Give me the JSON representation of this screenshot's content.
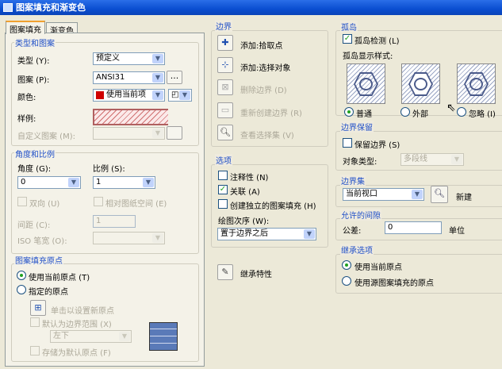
{
  "window": {
    "title": "图案填充和渐变色"
  },
  "tabs": [
    "图案填充",
    "渐变色"
  ],
  "type_pattern": {
    "group": "类型和图案",
    "type_label": "类型 (Y):",
    "type_value": "预定义",
    "pattern_label": "图案 (P):",
    "pattern_value": "ANSI31",
    "browse": "...",
    "color_label": "颜色:",
    "color_value": "使用当前项",
    "color_swatch": "#d00000",
    "swatch_label": "样例:",
    "custom_label": "自定义图案 (M):"
  },
  "angle_scale": {
    "group": "角度和比例",
    "angle_label": "角度 (G):",
    "angle_value": "0",
    "scale_label": "比例 (S):",
    "scale_value": "1",
    "double": "双向 (U)",
    "relative": "相对图纸空间 (E)",
    "spacing_label": "间距 (C):",
    "spacing_value": "1",
    "iso_label": "ISO 笔宽 (O):"
  },
  "origin": {
    "group": "图案填充原点",
    "use_current": "使用当前原点 (T)",
    "specified": "指定的原点",
    "click_set": "单击以设置新原点",
    "default_extent": "默认为边界范围 (X)",
    "extent_value": "左下",
    "store_default": "存储为默认原点 (F)"
  },
  "boundary": {
    "group": "边界",
    "add_pick": "添加:拾取点",
    "add_select": "添加:选择对象",
    "remove": "删除边界 (D)",
    "recreate": "重新创建边界 (R)",
    "view": "查看选择集 (V)"
  },
  "options": {
    "group": "选项",
    "annotative": "注释性 (N)",
    "associative": "关联 (A)",
    "independent": "创建独立的图案填充 (H)",
    "draw_order_label": "绘图次序 (W):",
    "draw_order_value": "置于边界之后"
  },
  "inherit": "继承特性",
  "islands": {
    "group": "孤岛",
    "detect": "孤岛检测 (L)",
    "style_label": "孤岛显示样式:",
    "normal": "普通",
    "outer": "外部",
    "ignore": "忽略 (I)"
  },
  "retain": {
    "group": "边界保留",
    "retain": "保留边界 (S)",
    "object_type_label": "对象类型:",
    "object_type_value": "多段线"
  },
  "boundary_set": {
    "group": "边界集",
    "value": "当前视口",
    "new": "新建"
  },
  "gap": {
    "group": "允许的间隙",
    "tolerance_label": "公差:",
    "tolerance_value": "0",
    "unit": "单位"
  },
  "inherit_options": {
    "group": "继承选项",
    "use_current": "使用当前原点",
    "use_source": "使用源图案填充的原点"
  }
}
